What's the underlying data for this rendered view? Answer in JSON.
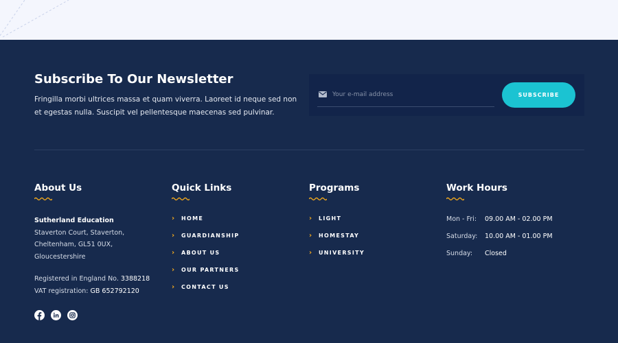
{
  "newsletter": {
    "title": "Subscribe To Our Newsletter",
    "text": "Fringilla morbi ultrices massa et quam viverra. Laoreet id neque sed non et egestas nulla. Suscipit vel pellentesque maecenas sed pulvinar.",
    "email_placeholder": "Your e-mail address",
    "email_value": "",
    "subscribe_label": "SUBSCRIBE",
    "mail_icon": "envelope-icon"
  },
  "about": {
    "heading": "About Us",
    "company": "Sutherland Education",
    "address": [
      "Staverton Court, Staverton,",
      "Cheltenham, GL51 0UX,",
      "Gloucestershire"
    ],
    "reg_label": "Registered in England No.",
    "reg_value": "3388218",
    "vat_label": "VAT registration:",
    "vat_value": "GB 652792120",
    "social_icons": [
      "facebook-icon",
      "linkedin-icon",
      "instagram-icon"
    ]
  },
  "quick_links": {
    "heading": "Quick Links",
    "items": [
      "HOME",
      "GUARDIANSHIP",
      "ABOUT US",
      "OUR PARTNERS",
      "CONTACT US"
    ]
  },
  "programs": {
    "heading": "Programs",
    "items": [
      "LIGHT",
      "HOMESTAY",
      "UNIVERSITY"
    ]
  },
  "work_hours": {
    "heading": "Work Hours",
    "rows": [
      {
        "day": "Mon - Fri:",
        "time": "09.00 AM - 02.00 PM"
      },
      {
        "day": "Saturday:",
        "time": "10.00 AM - 01.00 PM"
      },
      {
        "day": "Sunday:",
        "time": "Closed"
      }
    ]
  },
  "colors": {
    "footer_bg": "#172a4d",
    "form_bg": "#12244a",
    "accent_teal": "#1bc3d2",
    "accent_orange": "#f1a81d",
    "top_bg": "#f4f6fd"
  }
}
